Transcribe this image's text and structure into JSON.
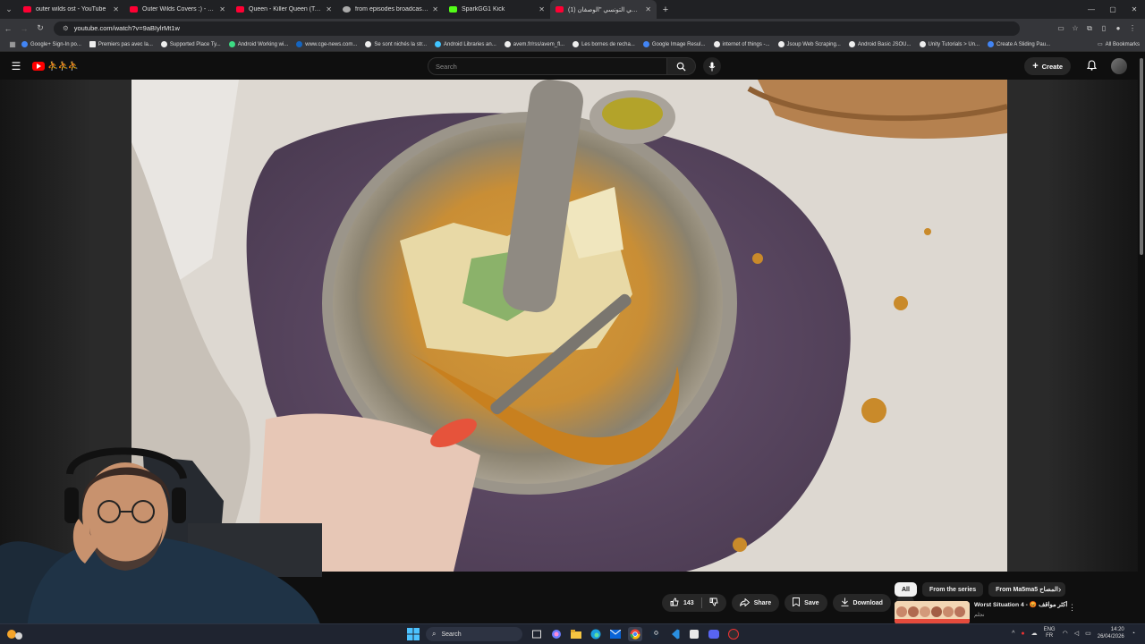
{
  "browser": {
    "tabs": [
      {
        "title": "outer wilds ost - YouTube",
        "favicon_color": "#ff0033"
      },
      {
        "title": "Outer Wilds Covers :) - YouTube",
        "favicon_color": "#ff0033"
      },
      {
        "title": "Queen - Killer Queen (Top Of The Pops...",
        "favicon_color": "#ff0033"
      },
      {
        "title": "from episodes broadcast schedule...",
        "favicon_color": "#aaaaaa"
      },
      {
        "title": "SparkGG1 Kick",
        "favicon_color": "#53fc18"
      },
      {
        "title": "(1) كفتاجي التونسي \"الوصفان\"",
        "favicon_color": "#ff0033",
        "active": true
      }
    ],
    "url": "youtube.com/watch?v=9aBIylrMt1w",
    "bookmarks": [
      "Google+ Sign-In po...",
      "Premiers pas avec la...",
      "Supported Place Ty...",
      "Android Working wi...",
      "www.cge-news.com...",
      "Se sont nichés la str...",
      "Android Libraries an...",
      "avem.fr/rss/avem_fl...",
      "Les bornes de recha...",
      "Google Image Resul...",
      "internet of things -...",
      "Jsoup Web Scraping...",
      "Android Basic JSOU...",
      "Unity Tutorials > Un...",
      "Create A Sliding Pau..."
    ],
    "all_bookmarks_label": "All Bookmarks"
  },
  "youtube": {
    "search_placeholder": "Search",
    "create_label": "Create",
    "actions": {
      "like_count": "143",
      "share_label": "Share",
      "save_label": "Save",
      "download_label": "Download"
    },
    "chips": [
      {
        "label": "All",
        "selected": true
      },
      {
        "label": "From the series",
        "selected": false
      },
      {
        "label": "From Ma5ma5 المصاح",
        "selected": false
      }
    ],
    "recommendation": {
      "title": "Worst Situation 4 - 😡 أكثر مواقف",
      "channel": "نجلم"
    }
  },
  "taskbar": {
    "search_label": "Search",
    "language_top": "ENG",
    "language_bottom": "FR",
    "time": "14:20",
    "date": "26/04/2026"
  },
  "icons": {
    "hamburger": "menu-icon",
    "search": "search-icon",
    "mic": "mic-icon",
    "bell": "bell-icon",
    "like": "thumbs-up-icon",
    "dislike": "thumbs-down-icon",
    "share": "share-icon",
    "save": "save-icon",
    "download": "download-icon"
  },
  "colors": {
    "youtube_red": "#ff0000",
    "background": "#0f0f0f",
    "pill": "#272727"
  }
}
